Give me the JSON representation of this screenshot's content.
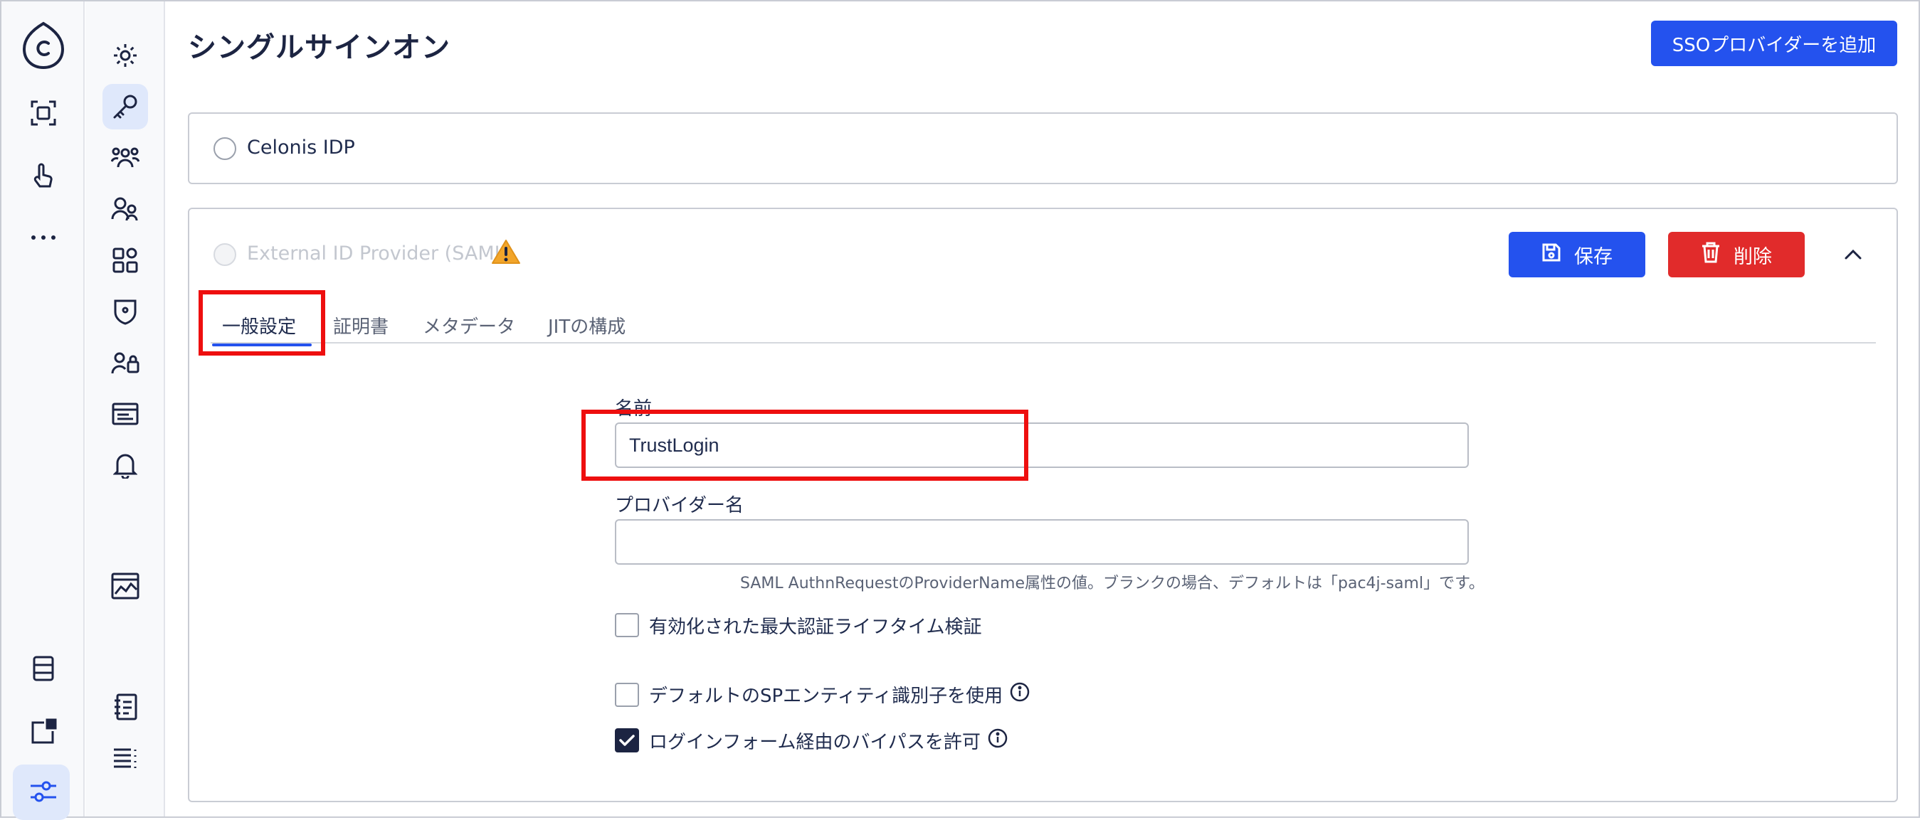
{
  "page": {
    "title": "シングルサインオン",
    "add_provider_label": "SSOプロバイダーを追加"
  },
  "providers": [
    {
      "name": "Celonis IDP"
    },
    {
      "name": "External ID Provider (SAML)"
    }
  ],
  "provider_actions": {
    "save_label": "保存",
    "delete_label": "削除"
  },
  "tabs": [
    {
      "label": "一般設定"
    },
    {
      "label": "証明書"
    },
    {
      "label": "メタデータ"
    },
    {
      "label": "JITの構成"
    }
  ],
  "form": {
    "name_label": "名前",
    "name_value": "TrustLogin",
    "provider_name_label": "プロバイダー名",
    "provider_name_value": "",
    "provider_name_help": "SAML AuthnRequestのProviderName属性の値。ブランクの場合、デフォルトは「pac4j-saml」です。",
    "checkbox_max_auth_lifetime": {
      "label": "有効化された最大認証ライフタイム検証",
      "checked": false
    },
    "checkbox_default_sp_entity": {
      "label": "デフォルトのSPエンティティ識別子を使用",
      "checked": false
    },
    "checkbox_bypass_login_form": {
      "label": "ログインフォーム経由のバイパスを許可",
      "checked": true
    }
  },
  "colors": {
    "primary": "#2452ee",
    "danger": "#e12b2b",
    "highlight": "#ee0f0f",
    "active_nav_bg": "#dfe8fb"
  },
  "icons": {
    "rail": [
      "celonis-logo-icon",
      "scan-icon",
      "hand-pointer-icon",
      "more-icon",
      "database-icon",
      "external-link-icon",
      "sliders-icon"
    ],
    "nav": [
      "gear-icon",
      "key-icon",
      "team-icon",
      "users-icon",
      "apps-icon",
      "shield-icon",
      "user-lock-icon",
      "browser-icon",
      "bell-icon",
      "chart-window-icon",
      "notebook-icon",
      "list-icon"
    ]
  }
}
